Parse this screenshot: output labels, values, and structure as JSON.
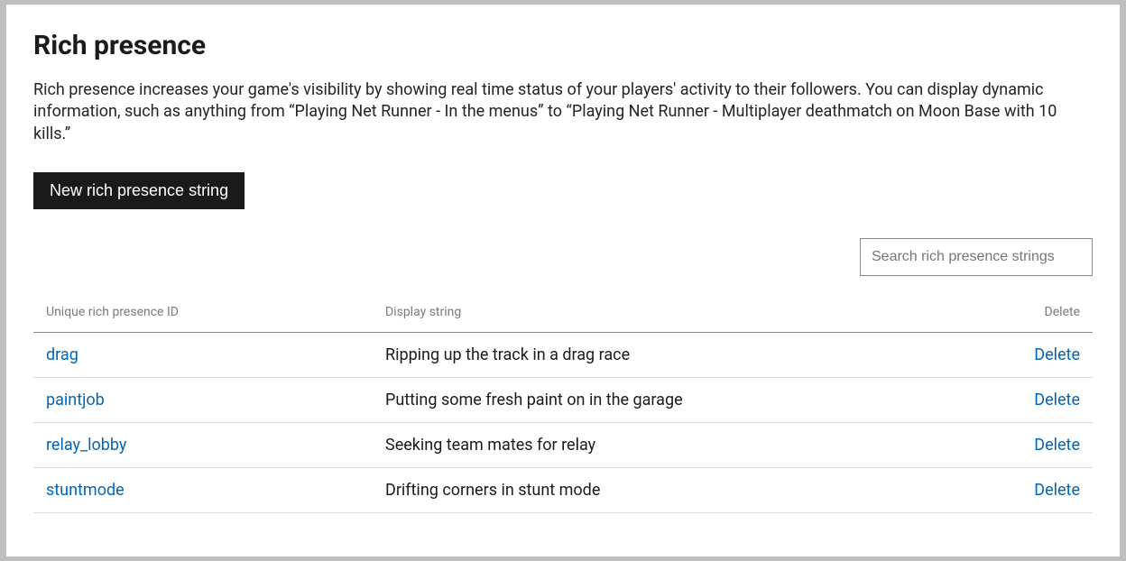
{
  "header": {
    "title": "Rich presence",
    "description": "Rich presence increases your game's visibility by showing real time status of your players' activity to their followers. You can display dynamic information, such as anything from “Playing Net Runner - In the menus” to “Playing Net Runner - Multiplayer deathmatch on Moon Base with 10 kills.”"
  },
  "actions": {
    "new_label": "New rich presence string"
  },
  "search": {
    "placeholder": "Search rich presence strings"
  },
  "table": {
    "col_id": "Unique rich presence ID",
    "col_display": "Display string",
    "col_delete": "Delete",
    "delete_label": "Delete",
    "rows": [
      {
        "id": "drag",
        "display": "Ripping up the track in a drag race"
      },
      {
        "id": "paintjob",
        "display": "Putting some fresh paint on in the garage"
      },
      {
        "id": "relay_lobby",
        "display": "Seeking team mates for relay"
      },
      {
        "id": "stuntmode",
        "display": "Drifting corners in stunt mode"
      }
    ]
  }
}
